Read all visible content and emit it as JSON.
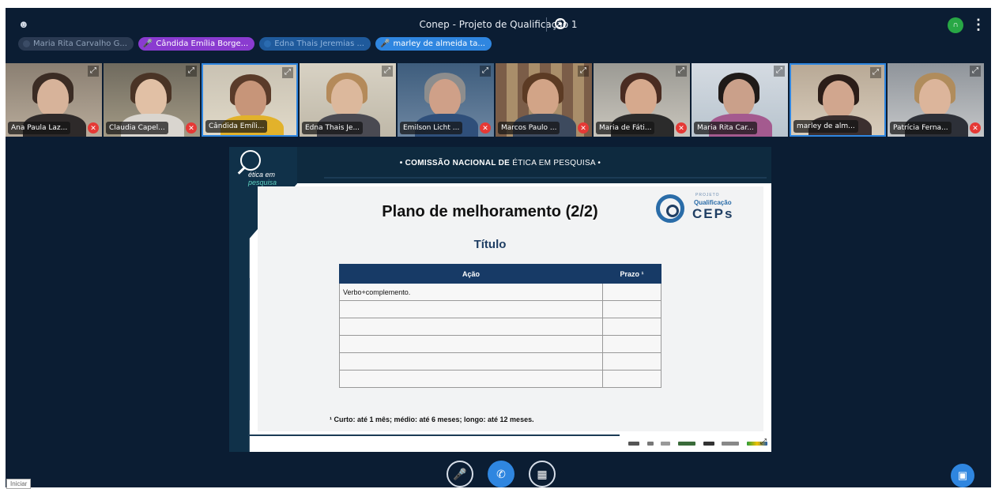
{
  "meeting": {
    "title": "Conep - Projeto de Qualificação 1"
  },
  "colors": {
    "background": "#0b1d33",
    "accent_blue": "#2f86e0",
    "active_speaker_purple": "#8a3bd0",
    "mute_red": "#e53935",
    "signal_green": "#28a745"
  },
  "speaker_chips": [
    {
      "label": "Maria Rita Carvalho G...",
      "style": "muted"
    },
    {
      "label": "Cândida Emília Borge...",
      "style": "purple"
    },
    {
      "label": "Edna Thais Jeremias ...",
      "style": "dim-blue"
    },
    {
      "label": "marley de almeida ta...",
      "style": "blue"
    }
  ],
  "participants": [
    {
      "name": "Ana Paula Laz...",
      "muted": true
    },
    {
      "name": "Claudia Capel...",
      "muted": true
    },
    {
      "name": "Cândida Emíli...",
      "muted": false,
      "active": true
    },
    {
      "name": "Edna Thais Je...",
      "muted": false
    },
    {
      "name": "Emilson Licht ...",
      "muted": true
    },
    {
      "name": "Marcos Paulo ...",
      "muted": true
    },
    {
      "name": "Maria de Fáti...",
      "muted": true
    },
    {
      "name": "Maria Rita Car...",
      "muted": false
    },
    {
      "name": "marley de alm...",
      "muted": false,
      "active": true
    },
    {
      "name": "Patrícia Ferna...",
      "muted": true
    }
  ],
  "slide": {
    "header_bold": "• COMISSÃO NACIONAL DE",
    "header_rest": " ÉTICA EM PESQUISA •",
    "logo_line1": "ética em",
    "logo_line2": "pesquisa",
    "title": "Plano de melhoramento (2/2)",
    "subtitle": "Título",
    "ceps_projeto": "PROJETO",
    "ceps_qualificacao": "Qualificação",
    "ceps_name": "CEPs",
    "table": {
      "headers": [
        "Ação",
        "Prazo ¹"
      ],
      "rows": [
        [
          "Verbo+complemento.",
          ""
        ],
        [
          "",
          ""
        ],
        [
          "",
          ""
        ],
        [
          "",
          ""
        ],
        [
          "",
          ""
        ],
        [
          "",
          ""
        ]
      ]
    },
    "footnote": "¹ Curto: até 1 mês; médio: até 6 meses; longo: até 12 meses."
  },
  "tooltip": "Iniciar"
}
